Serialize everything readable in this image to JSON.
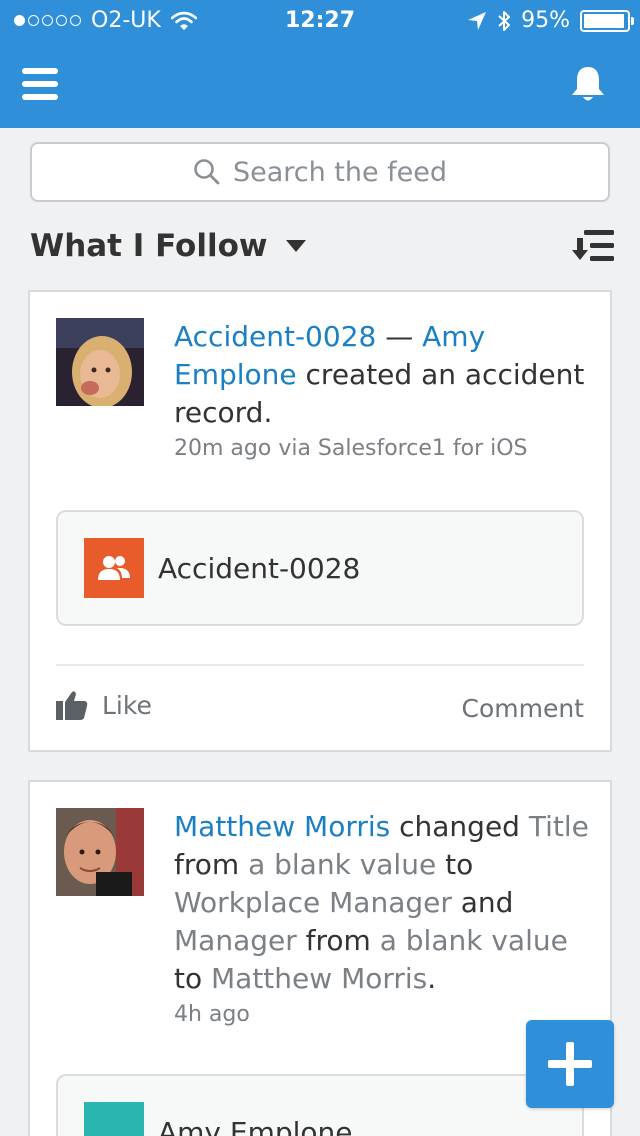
{
  "status_bar": {
    "carrier": "O2-UK",
    "time": "12:27",
    "battery": "95%",
    "battery_level": 0.95
  },
  "search": {
    "placeholder": "Search the feed"
  },
  "feed": {
    "filter_label": "What I Follow",
    "posts": [
      {
        "record_link": "Accident-0028",
        "dash": " — ",
        "actor": "Amy Emplone",
        "action": " created an accident record.",
        "meta": "20m ago via Salesforce1 for iOS",
        "attachment_label": "Accident-0028",
        "like_label": "Like",
        "comment_label": "Comment"
      },
      {
        "actor": "Matthew Morris",
        "t1": " changed ",
        "field1": "Title",
        "t2": " from ",
        "val1": "a blank value",
        "t3": " to ",
        "val2": "Workplace Manager",
        "t4": " and ",
        "field2": "Manager",
        "t5": " from ",
        "val3": "a blank value",
        "t6": " to ",
        "val4": "Matthew Morris",
        "t7": ".",
        "meta": "4h ago",
        "attachment_label": "Amy Emplone"
      }
    ]
  },
  "colors": {
    "header": "#2f8fd9",
    "link": "#1a7fc4",
    "accident_icon": "#e85c2b",
    "contact_icon": "#2bb5b0"
  },
  "icons": [
    "signal-dots-icon",
    "wifi-icon",
    "location-arrow-icon",
    "bluetooth-icon",
    "battery-icon",
    "hamburger-menu-icon",
    "bell-icon",
    "search-icon",
    "dropdown-caret-icon",
    "sort-icon",
    "group-icon",
    "thumbs-up-icon",
    "plus-icon"
  ]
}
